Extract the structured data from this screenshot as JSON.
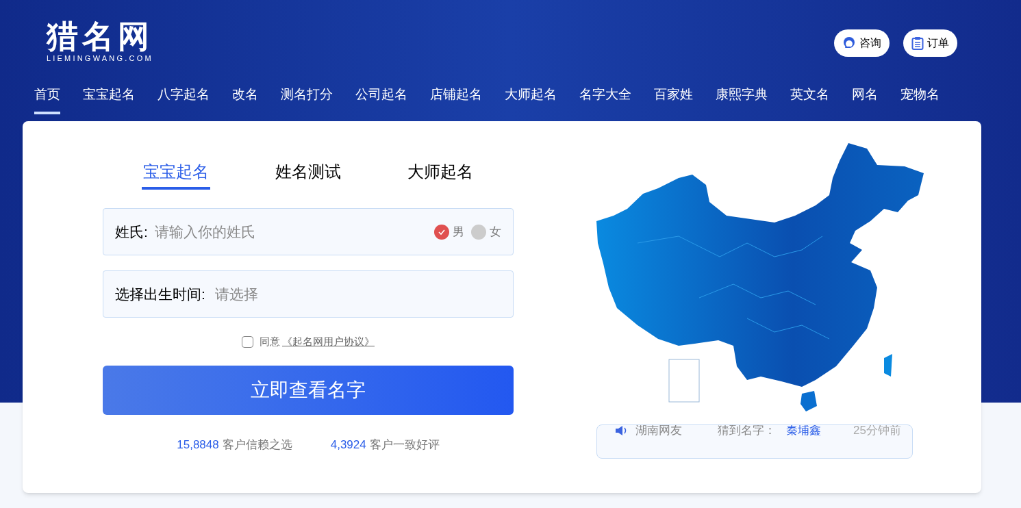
{
  "logo": {
    "name": "猎名网",
    "domain": "LIEMINGWANG.COM"
  },
  "header_buttons": [
    {
      "kind": "consult",
      "label": "咨询"
    },
    {
      "kind": "order",
      "label": "订单"
    }
  ],
  "nav": [
    {
      "label": "首页",
      "selected": true
    },
    {
      "label": "宝宝起名",
      "selected": false
    },
    {
      "label": "八字起名",
      "selected": false
    },
    {
      "label": "改名",
      "selected": false
    },
    {
      "label": "测名打分",
      "selected": false
    },
    {
      "label": "公司起名",
      "selected": false
    },
    {
      "label": "店铺起名",
      "selected": false
    },
    {
      "label": "大师起名",
      "selected": false
    },
    {
      "label": "名字大全",
      "selected": false
    },
    {
      "label": "百家姓",
      "selected": false
    },
    {
      "label": "康熙字典",
      "selected": false
    },
    {
      "label": "英文名",
      "selected": false
    },
    {
      "label": "网名",
      "selected": false
    },
    {
      "label": "宠物名",
      "selected": false
    }
  ],
  "tabs": [
    {
      "label": "宝宝起名",
      "selected": true
    },
    {
      "label": "姓名测试",
      "selected": false
    },
    {
      "label": "大师起名",
      "selected": false
    }
  ],
  "surname": {
    "label": "姓氏:",
    "placeholder": "请输入你的姓氏"
  },
  "gender": [
    {
      "label": "男",
      "selected": true
    },
    {
      "label": "女",
      "selected": false
    }
  ],
  "birth": {
    "label": "选择出生时间:",
    "placeholder": "请选择"
  },
  "agreement": {
    "checked": false,
    "text": "同意",
    "link": "《起名网用户协议》"
  },
  "submit": "立即查看名字",
  "stats": [
    {
      "number": "15,8848",
      "text": "客户信赖之选"
    },
    {
      "number": "4,3924",
      "text": "客户一致好评"
    }
  ],
  "ticker": [
    {
      "user": "湖南网友",
      "action": "猜到名字：",
      "name": "秦埔鑫",
      "time": "25分钟前"
    }
  ]
}
